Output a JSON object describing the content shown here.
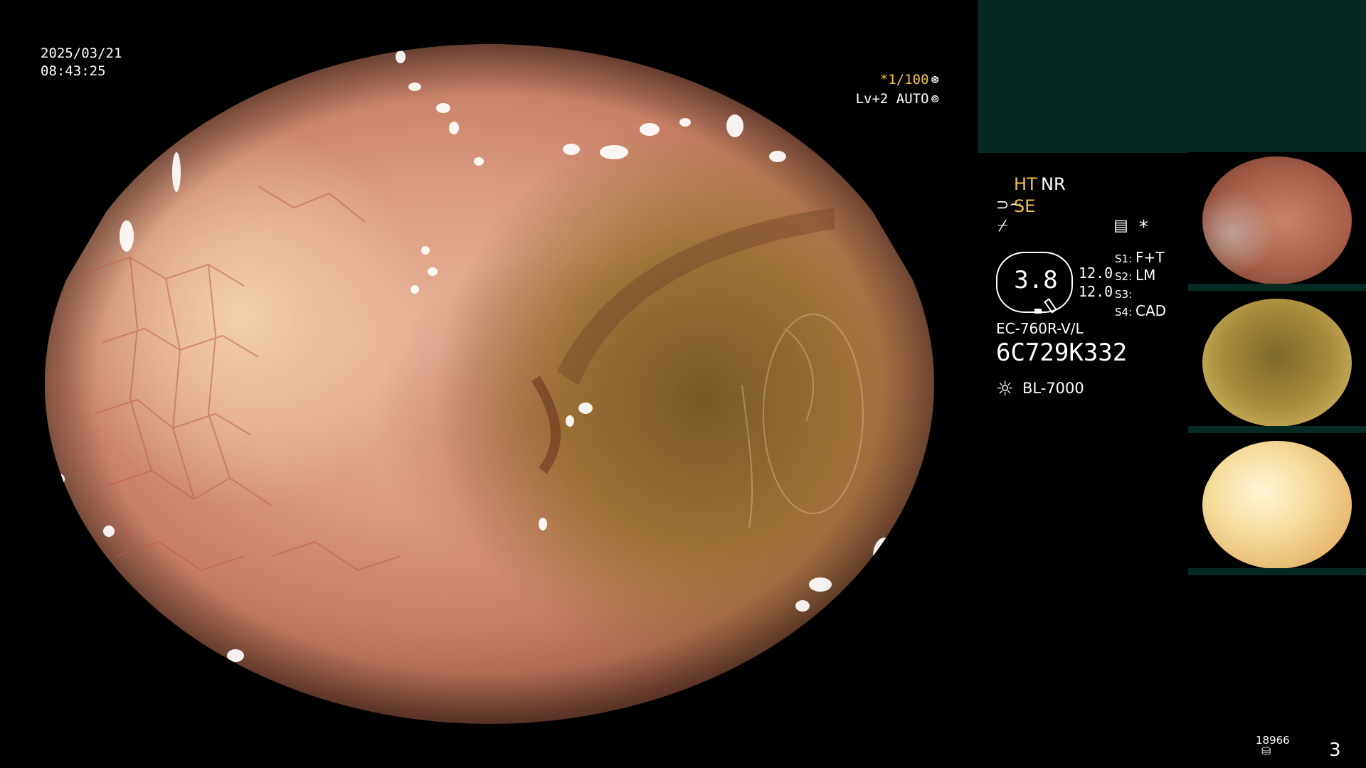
{
  "osd": {
    "date": "2025/03/21",
    "time": "08:43:25",
    "shutter": "*1/100",
    "shutter_icon": "shutter-icon",
    "level": "Lv+2 AUTO",
    "level_icon": "auto-iris-icon"
  },
  "panel": {
    "ht": "HT",
    "nr": "NR",
    "se_icon": "enhance-icon",
    "se_icon_glyph": "⊃~",
    "se": "SE",
    "hatch_icon": "color-mode-icon",
    "hatch_glyph": "⌿",
    "settings_icon": "settings-icon",
    "settings_glyph": "▤",
    "star_icon": "star-icon",
    "star_glyph": "*",
    "zoom": {
      "value": "3.8",
      "range_1": "12.0",
      "range_2": "12.0"
    },
    "slots": [
      {
        "key": "S1:",
        "value": "F+T"
      },
      {
        "key": "S2:",
        "value": "LM"
      },
      {
        "key": "S3:",
        "value": ""
      },
      {
        "key": "S4:",
        "value": "CAD"
      }
    ],
    "scope_model": "EC-760R-V/L",
    "serial": "6C729K332",
    "light_icon": "light-source-icon",
    "light_icon_glyph": "☼",
    "light_source": "BL-7000",
    "colors": {
      "accent": "#f2c14e",
      "panel_box": "#062a23"
    }
  },
  "footer": {
    "record_count": "18966",
    "record_icon": "storage-icon",
    "record_glyph": "⛁",
    "page_number": "3"
  }
}
